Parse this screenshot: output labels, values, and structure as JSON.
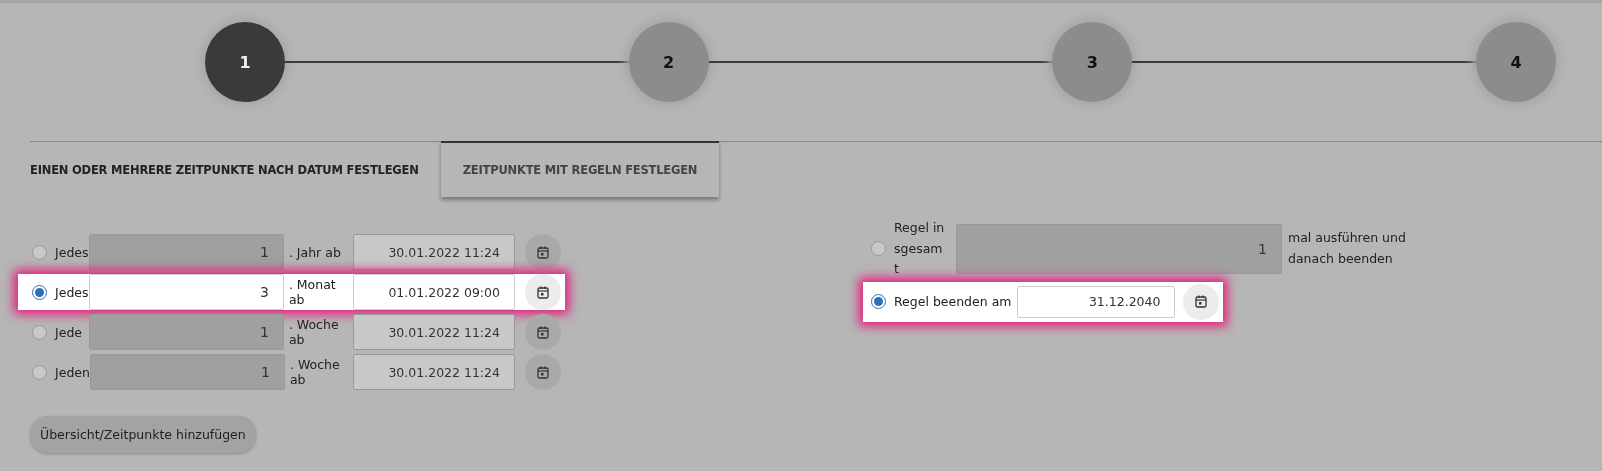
{
  "steps": [
    {
      "label": "1",
      "selected": true
    },
    {
      "label": "2",
      "selected": false
    },
    {
      "label": "3",
      "selected": false
    },
    {
      "label": "4",
      "selected": false
    }
  ],
  "tabs": [
    {
      "label": "EINEN ODER MEHRERE ZEITPUNKTE NACH DATUM FESTLEGEN",
      "selected": false
    },
    {
      "label": "ZEITPUNKTE MIT REGELN FESTLEGEN",
      "selected": true
    }
  ],
  "repeat_options": [
    {
      "label": "Jedes",
      "count": "1",
      "unit": ". Jahr ab",
      "date": "30.01.2022 11:24",
      "selected": false
    },
    {
      "label": "Jedes",
      "count": "3",
      "unit": ". Monat ab",
      "date": "01.01.2022 09:00",
      "selected": true
    },
    {
      "label": "Jede",
      "count": "1",
      "unit": ". Woche ab",
      "date": "30.01.2022 11:24",
      "selected": false
    },
    {
      "label": "Jeden",
      "count": "1",
      "unit": ". Woche ab",
      "date": "30.01.2022 11:24",
      "selected": false
    }
  ],
  "end_options": [
    {
      "kind": "count",
      "label": "Regel insgesamt",
      "count": "1",
      "suffix": "mal ausführen und danach beenden",
      "selected": false
    },
    {
      "kind": "date",
      "label": "Regel beenden am",
      "date": "31.12.2040",
      "selected": true
    }
  ],
  "add_button": "Übersicht/Zeitpunkte hinzufügen"
}
